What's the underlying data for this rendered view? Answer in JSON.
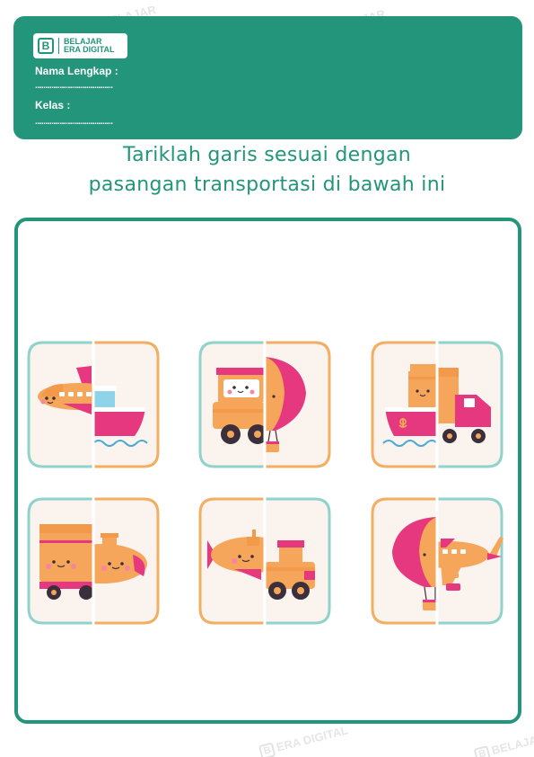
{
  "watermark": {
    "brand_line1": "BELAJAR",
    "brand_line2": "ERA DIGITAL",
    "mark": "B"
  },
  "header": {
    "logo": {
      "mark": "B",
      "line1": "BELAJAR",
      "line2": "ERA DIGITAL"
    },
    "name_label": "Nama Lengkap :",
    "name_dots": "......................................",
    "class_label": "Kelas :",
    "class_dots": "......................................"
  },
  "title": {
    "line1": "Tariklah garis sesuai dengan",
    "line2": "pasangan transportasi di bawah ini"
  },
  "cards": [
    {
      "left": "airplane",
      "right": "ship"
    },
    {
      "left": "train",
      "right": "hot-air-balloon"
    },
    {
      "left": "ship",
      "right": "truck"
    },
    {
      "left": "truck",
      "right": "submarine"
    },
    {
      "left": "submarine",
      "right": "train"
    },
    {
      "left": "hot-air-balloon",
      "right": "airplane"
    }
  ],
  "colors": {
    "brand_green": "#23957a",
    "teal_frame": "#8fd3cb",
    "orange_frame": "#f2ae63",
    "pink": "#e6387f",
    "orange": "#f6a65a",
    "dark": "#3a2f3a",
    "cream": "#fbf3ed"
  }
}
